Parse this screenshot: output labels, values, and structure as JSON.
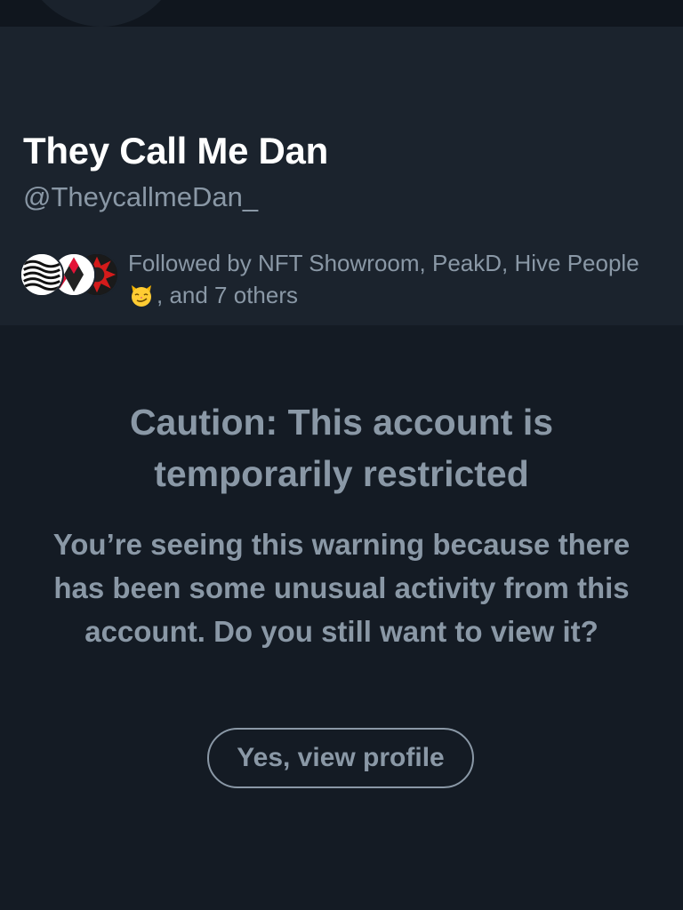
{
  "profile": {
    "display_name": "They Call Me Dan",
    "handle": "@TheycallmeDan_",
    "followed_by_prefix": "Followed by NFT Showroom, PeakD, Hive People",
    "followed_by_suffix": ", and 7 others",
    "mutual_avatars": [
      "nft-showroom-avatar",
      "peakd-avatar",
      "hive-people-avatar"
    ],
    "emoji": "smirking-cat-face"
  },
  "warning": {
    "title": "Caution: This account is temporarily restricted",
    "body": "You’re seeing this warning because there has been some unusual activity from this account. Do you still want to view it?",
    "button_label": "Yes, view profile"
  },
  "colors": {
    "background": "#141b24",
    "header_background": "#1b232d",
    "muted_text": "#8a98a6",
    "name_text": "#ffffff"
  }
}
